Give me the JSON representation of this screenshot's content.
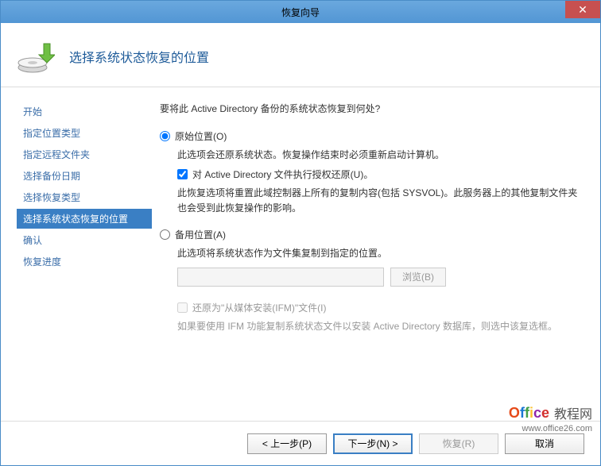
{
  "window": {
    "title": "恢复向导"
  },
  "header": {
    "title": "选择系统状态恢复的位置"
  },
  "sidebar": {
    "items": [
      {
        "label": "开始"
      },
      {
        "label": "指定位置类型"
      },
      {
        "label": "指定远程文件夹"
      },
      {
        "label": "选择备份日期"
      },
      {
        "label": "选择恢复类型"
      },
      {
        "label": "选择系统状态恢复的位置"
      },
      {
        "label": "确认"
      },
      {
        "label": "恢复进度"
      }
    ],
    "activeIndex": 5
  },
  "main": {
    "prompt": "要将此 Active Directory 备份的系统状态恢复到何处?",
    "original": {
      "label": "原始位置(O)",
      "desc": "此选项会还原系统状态。恢复操作结束时必须重新启动计算机。",
      "authCheck": "对 Active Directory 文件执行授权还原(U)。",
      "authDesc": "此恢复选项将重置此域控制器上所有的复制内容(包括 SYSVOL)。此服务器上的其他复制文件夹也会受到此恢复操作的影响。"
    },
    "alternate": {
      "label": "备用位置(A)",
      "desc": "此选项将系统状态作为文件集复制到指定的位置。",
      "browseBtn": "浏览(B)"
    },
    "ifm": {
      "label": "还原为\"从媒体安装(IFM)\"文件(I)",
      "desc": "如果要使用 IFM 功能复制系统状态文件以安装 Active Directory 数据库，则选中该复选框。"
    }
  },
  "footer": {
    "back": "< 上一步(P)",
    "next": "下一步(N) >",
    "recover": "恢复(R)",
    "cancel": "取消"
  },
  "watermark": {
    "brand": "Office",
    "suffix": "教程网",
    "url": "www.office26.com"
  }
}
